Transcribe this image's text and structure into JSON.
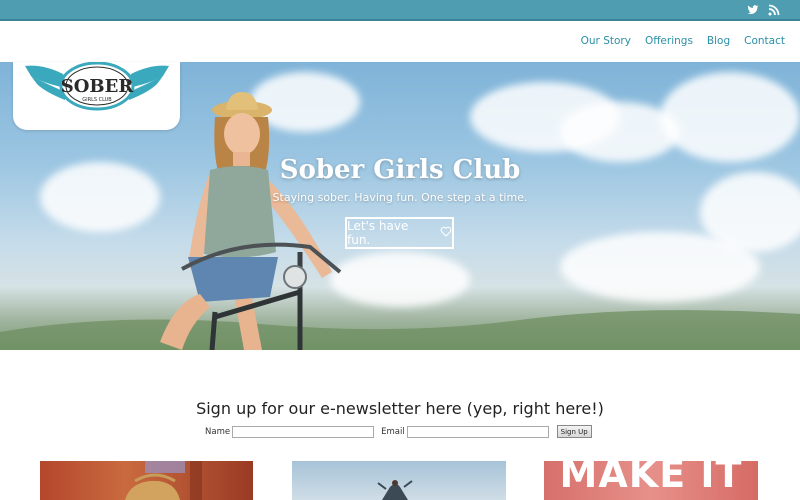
{
  "topbar": {
    "social": [
      {
        "icon": "twitter-icon"
      },
      {
        "icon": "rss-icon"
      }
    ],
    "color": "#4e9db1"
  },
  "nav": {
    "items": [
      {
        "label": "Our Story"
      },
      {
        "label": "Offerings"
      },
      {
        "label": "Blog"
      },
      {
        "label": "Contact"
      }
    ],
    "color": "#2b8fa5"
  },
  "logo": {
    "word": "SOBER",
    "sub": "GIRLS CLUB",
    "color": "#3aa9bd"
  },
  "hero": {
    "title": "Sober Girls Club",
    "subtitle": "Staying sober. Having fun. One step at a time.",
    "button_label": "Let's have fun.",
    "button_icon": "heart-icon"
  },
  "newsletter": {
    "title": "Sign up for our e-newsletter here (yep, right here!)",
    "name_label": "Name",
    "email_label": "Email",
    "name_value": "",
    "email_value": "",
    "submit_label": "Sign Up"
  },
  "thumbnails": [
    {
      "caption": ""
    },
    {
      "caption": ""
    },
    {
      "caption": "MAKE IT"
    }
  ]
}
